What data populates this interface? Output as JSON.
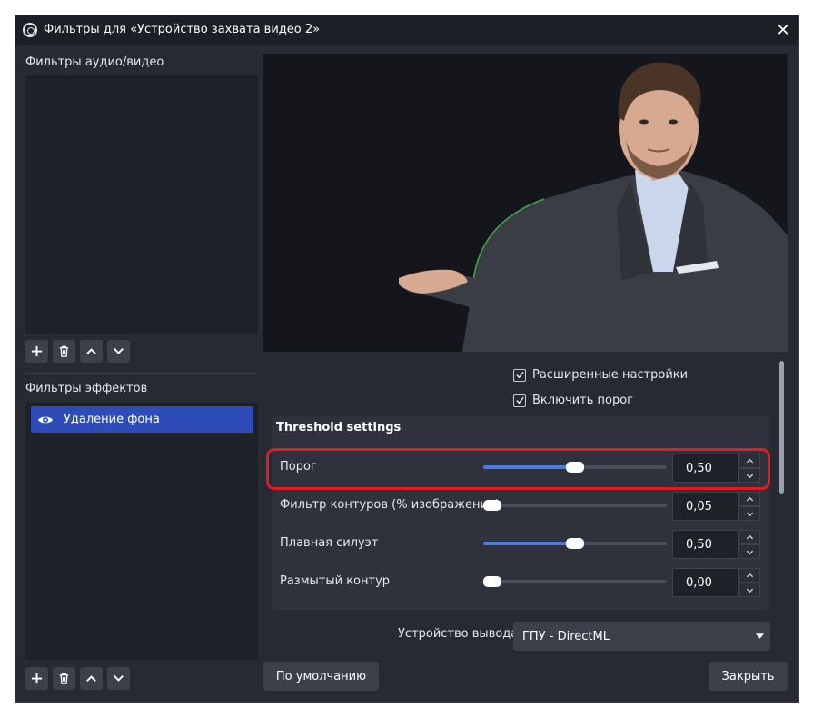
{
  "window": {
    "title": "Фильтры для «Устройство захвата видео 2»",
    "close_glyph": "✕"
  },
  "av_filters": {
    "label": "Фильтры аудио/видео",
    "items": []
  },
  "effect_filters": {
    "label": "Фильтры эффектов",
    "items": [
      {
        "label": "Удаление фона",
        "visible": true,
        "selected": true
      }
    ]
  },
  "toolbar": {
    "add_icon": "plus-icon",
    "remove_icon": "trash-icon",
    "up_icon": "chevron-up-icon",
    "down_icon": "chevron-down-icon"
  },
  "properties": {
    "advanced_settings": {
      "label": "Расширенные настройки",
      "checked": true
    },
    "enable_threshold": {
      "label": "Включить порог",
      "checked": true
    },
    "threshold_group": {
      "title": "Threshold settings",
      "rows": [
        {
          "label": "Порог",
          "value": "0,50",
          "fraction": 0.5
        },
        {
          "label": "Фильтр контуров (% изображения)",
          "value": "0,05",
          "fraction": 0.05
        },
        {
          "label": "Плавная силуэт",
          "value": "0,50",
          "fraction": 0.5
        },
        {
          "label": "Размытый контур",
          "value": "0,00",
          "fraction": 0.0
        }
      ]
    },
    "output_device": {
      "label": "Устройство вывода",
      "value": "ГПУ - DirectML"
    }
  },
  "buttons": {
    "defaults": "По умолчанию",
    "close": "Закрыть"
  },
  "colors": {
    "window_bg": "#272a33",
    "accent": "#2d4cb8",
    "slider_fill": "#4a7be0",
    "highlight": "#e01b24"
  }
}
